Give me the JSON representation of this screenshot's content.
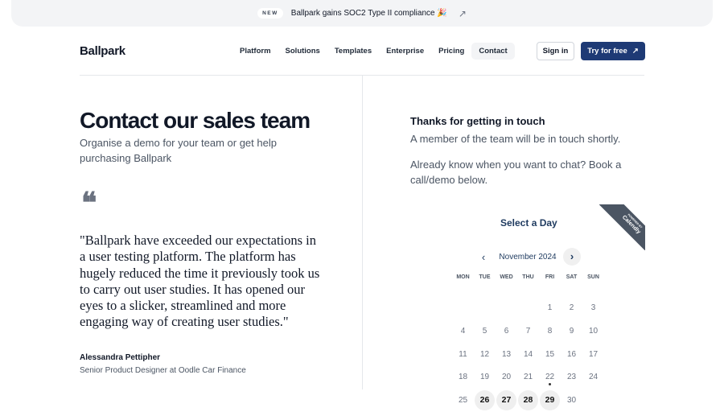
{
  "banner": {
    "badge": "NEW",
    "text": "Ballpark gains SOC2 Type II compliance 🎉"
  },
  "header": {
    "logo": "Ballpark",
    "nav": [
      "Platform",
      "Solutions",
      "Templates",
      "Enterprise",
      "Pricing",
      "Contact"
    ],
    "active": "Contact",
    "sign_in": "Sign in",
    "try_free": "Try for free"
  },
  "left": {
    "title": "Contact our sales team",
    "subtitle": "Organise a demo for your team or get help purchasing Ballpark",
    "quote": "\"Ballpark have exceeded our expectations in a user testing platform. The platform has hugely reduced the time it previously took us to carry out user studies. It has opened our eyes to a slicker, streamlined and more engaging way of creating user studies.\"",
    "author": "Alessandra Pettipher",
    "role": "Senior Product Designer at Oodle Car Finance"
  },
  "right": {
    "thanks": "Thanks for getting in touch",
    "p1": "A member of the team will be in touch shortly.",
    "p2": "Already know when you want to chat? Book a call/demo below.",
    "select_day": "Select a Day",
    "ribbon_small": "POWERED BY",
    "ribbon": "Calendly",
    "month": "November 2024",
    "weekdays": [
      "MON",
      "TUE",
      "WED",
      "THU",
      "FRI",
      "SAT",
      "SUN"
    ],
    "first_weekday_index": 4,
    "days_shown": 30,
    "available_days": [
      26,
      27,
      28,
      29
    ],
    "today": 22
  }
}
